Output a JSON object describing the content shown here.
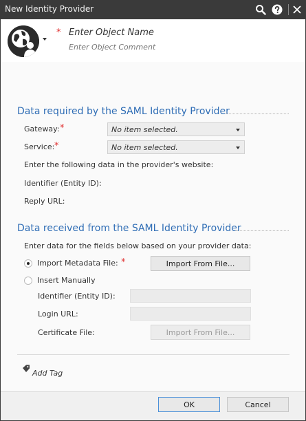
{
  "window": {
    "title": "New Identity Provider"
  },
  "titlebar_icons": [
    "search-icon",
    "help-icon",
    "close-icon"
  ],
  "header": {
    "object_name_placeholder": "Enter Object Name",
    "object_comment_placeholder": "Enter Object Comment",
    "required_mark": "*"
  },
  "section_required": {
    "title": "Data required by the SAML Identity Provider",
    "gateway_label": "Gateway:",
    "gateway_value": "No item selected.",
    "service_label": "Service:",
    "service_value": "No item selected.",
    "instruction": "Enter the following data in the provider's website:",
    "identifier_label": "Identifier (Entity ID):",
    "reply_url_label": "Reply URL:"
  },
  "section_received": {
    "title": "Data received from the SAML Identity Provider",
    "instruction": "Enter data for the fields below based on your provider data:",
    "import_metadata_label": "Import Metadata File:",
    "import_button_label": "Import From File...",
    "insert_manually_label": "Insert Manually",
    "identifier_label": "Identifier (Entity ID):",
    "login_url_label": "Login URL:",
    "certificate_label": "Certificate File:",
    "certificate_button_label": "Import From File..."
  },
  "tags": {
    "add_tag_label": "Add Tag"
  },
  "footer": {
    "ok_label": "OK",
    "cancel_label": "Cancel"
  },
  "colors": {
    "section_title": "#2f6db5",
    "required": "#e03030",
    "titlebar": "#3a3a3a",
    "focus_border": "#4a90d9"
  }
}
